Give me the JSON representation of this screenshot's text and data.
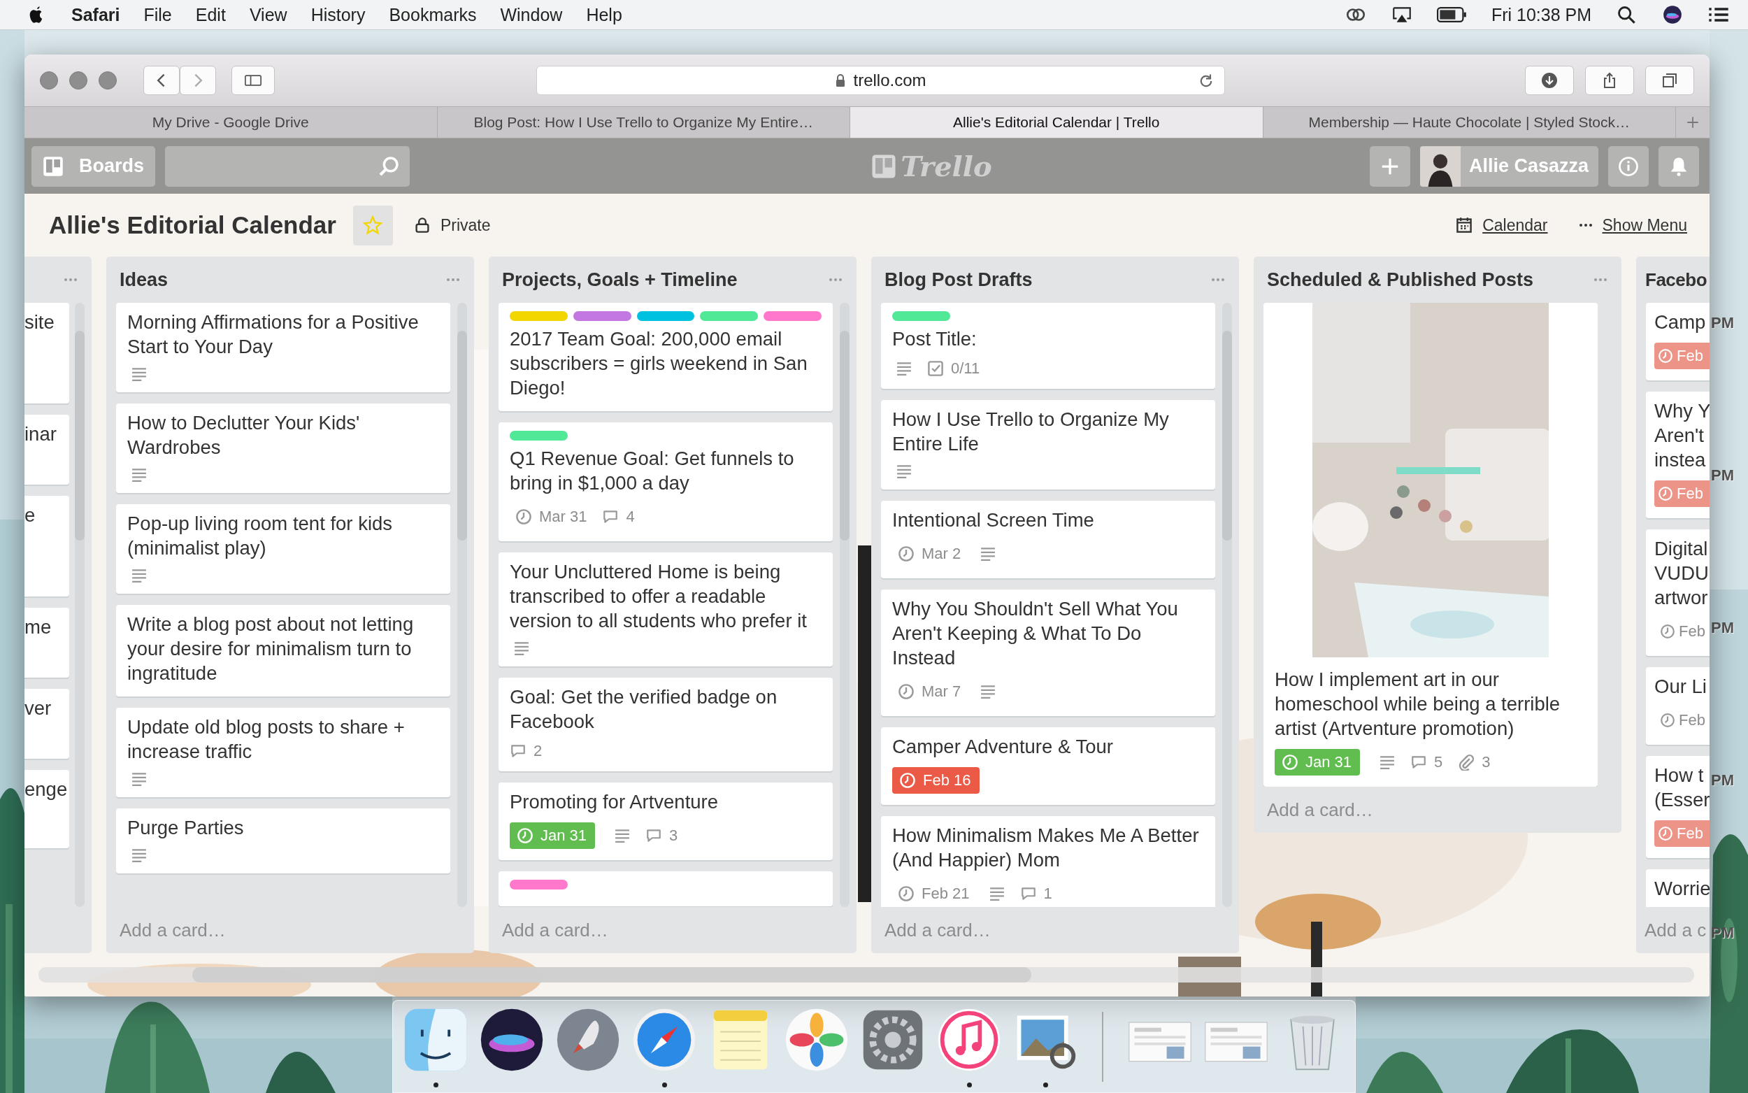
{
  "menu_bar": {
    "app_name": "Safari",
    "menus": [
      "File",
      "Edit",
      "View",
      "History",
      "Bookmarks",
      "Window",
      "Help"
    ],
    "clock": "Fri 10:38 PM"
  },
  "browser": {
    "address": "trello.com",
    "tabs": [
      {
        "title": "My Drive - Google Drive",
        "selected": false
      },
      {
        "title": "Blog Post: How I Use Trello to Organize My Entire…",
        "selected": false
      },
      {
        "title": "Allie's Editorial Calendar | Trello",
        "selected": true
      },
      {
        "title": "Membership — Haute Chocolate | Styled Stock…",
        "selected": false
      }
    ]
  },
  "trello_header": {
    "boards_button": "Boards",
    "logo": "Trello",
    "user_name": "Allie Casazza"
  },
  "board": {
    "title": "Allie's Editorial Calendar",
    "starred": true,
    "visibility": "Private",
    "calendar_link": "Calendar",
    "menu_link": "Show Menu"
  },
  "lists": [
    {
      "cards": [
        {
          "title": "site"
        },
        {
          "title": "inar"
        },
        {
          "title": "e"
        },
        {
          "title": "me"
        },
        {
          "title": "ver"
        },
        {
          "title": "enge"
        }
      ]
    },
    {
      "title": "Ideas",
      "add_card": "Add a card…",
      "cards": [
        {
          "title": "Morning Affirmations for a Positive Start to Your Day",
          "badges": [
            {
              "kind": "description"
            }
          ]
        },
        {
          "title": "How to Declutter Your Kids' Wardrobes",
          "badges": [
            {
              "kind": "description"
            }
          ]
        },
        {
          "title": "Pop-up living room tent for kids (minimalist play)",
          "badges": [
            {
              "kind": "description"
            }
          ]
        },
        {
          "title": "Write a blog post about not letting your desire for minimalism turn to ingratitude"
        },
        {
          "title": "Update old blog posts to share + increase traffic",
          "badges": [
            {
              "kind": "description"
            }
          ]
        },
        {
          "title": "Purge Parties",
          "badges": [
            {
              "kind": "description"
            }
          ]
        }
      ]
    },
    {
      "title": "Projects, Goals + Timeline",
      "add_card": "Add a card…",
      "cards": [
        {
          "labels": [
            {
              "color": "#f2d600"
            },
            {
              "color": "#c377e0"
            },
            {
              "color": "#00c2e0"
            },
            {
              "color": "#51e898"
            },
            {
              "color": "#ff78cb"
            }
          ],
          "title": "2017 Team Goal: 200,000 email subscribers = girls weekend in San Diego!"
        },
        {
          "labels": [
            {
              "color": "#51e898"
            }
          ],
          "title": "Q1 Revenue Goal: Get funnels to bring in $1,000 a day",
          "badges": [
            {
              "kind": "due",
              "text": "Mar 31"
            },
            {
              "kind": "comments",
              "text": "4"
            }
          ]
        },
        {
          "title": "Your Uncluttered Home is being transcribed to offer a readable version to all students who prefer it",
          "badges": [
            {
              "kind": "description"
            }
          ]
        },
        {
          "title": "Goal: Get the verified badge on Facebook",
          "badges": [
            {
              "kind": "comments",
              "text": "2"
            }
          ]
        },
        {
          "title": "Promoting for Artventure",
          "badges": [
            {
              "kind": "due",
              "color": "#61bd4f",
              "text": "Jan 31"
            },
            {
              "kind": "description"
            },
            {
              "kind": "comments",
              "text": "3"
            }
          ]
        },
        {
          "labels": [
            {
              "color": "#ff78cb"
            }
          ]
        }
      ]
    },
    {
      "title": "Blog Post Drafts",
      "add_card": "Add a card…",
      "cards": [
        {
          "labels": [
            {
              "color": "#51e898"
            }
          ],
          "title": "Post Title:",
          "badges": [
            {
              "kind": "description"
            },
            {
              "kind": "checklist",
              "text": "0/11"
            }
          ]
        },
        {
          "title": "How I Use Trello to Organize My Entire Life",
          "badges": [
            {
              "kind": "description"
            }
          ]
        },
        {
          "title": "Intentional Screen Time",
          "badges": [
            {
              "kind": "due",
              "text": "Mar 2"
            },
            {
              "kind": "description"
            }
          ]
        },
        {
          "title": "Why You Shouldn't Sell What You Aren't Keeping & What To Do Instead",
          "badges": [
            {
              "kind": "due",
              "text": "Mar 7"
            },
            {
              "kind": "description"
            }
          ]
        },
        {
          "title": "Camper Adventure & Tour",
          "badges": [
            {
              "kind": "due",
              "color": "#eb5a46",
              "text": "Feb 16"
            }
          ]
        },
        {
          "title": "How Minimalism Makes Me A Better (And Happier) Mom",
          "badges": [
            {
              "kind": "due",
              "text": "Feb 21"
            },
            {
              "kind": "description"
            },
            {
              "kind": "comments",
              "text": "1"
            }
          ]
        }
      ]
    },
    {
      "title": "Scheduled & Published Posts",
      "add_card": "Add a card…",
      "cards": [
        {
          "cover": {
            "kind": "picture"
          },
          "title": "How I implement art in our homeschool while being a terrible artist (Artventure promotion)",
          "badges": [
            {
              "kind": "due",
              "color": "#61bd4f",
              "text": "Jan 31"
            },
            {
              "kind": "description"
            },
            {
              "kind": "comments",
              "text": "5"
            },
            {
              "kind": "attachments",
              "text": "3"
            }
          ]
        }
      ]
    },
    {
      "title": "Facebo",
      "add_card": "Add a c",
      "cards": [
        {
          "title": "Camp",
          "badges": [
            {
              "kind": "due",
              "color": "#ec9488",
              "text": "Feb"
            }
          ]
        },
        {
          "title": "Why Y\nAren't\ninstea",
          "badges": [
            {
              "kind": "due",
              "color": "#ec9488",
              "text": "Feb"
            }
          ]
        },
        {
          "title": "Digital\nVUDU\nartwor",
          "badges": [
            {
              "kind": "due",
              "text": "Feb"
            }
          ]
        },
        {
          "title": "Our Li",
          "badges": [
            {
              "kind": "due",
              "text": "Feb"
            }
          ]
        },
        {
          "title": "How t\n(Esser",
          "badges": [
            {
              "kind": "due",
              "color": "#ec9488",
              "text": "Feb"
            }
          ]
        },
        {
          "title": "Worrie"
        }
      ]
    }
  ],
  "desktop_labels": [
    "PM",
    "PM",
    "PM",
    "PM",
    "PM"
  ]
}
